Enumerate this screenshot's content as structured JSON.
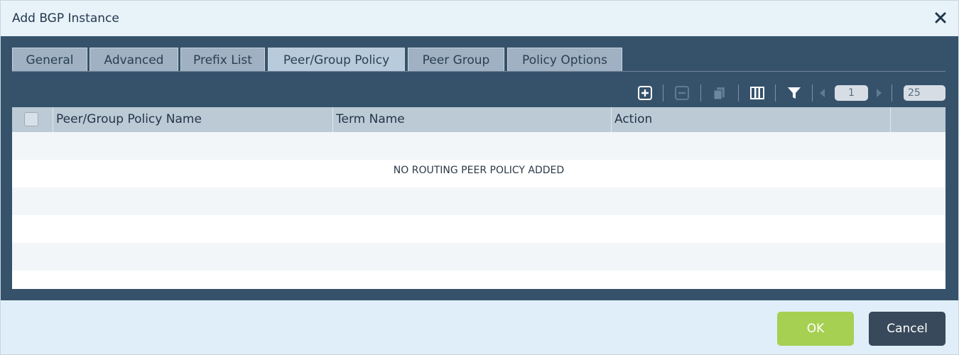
{
  "dialog": {
    "title": "Add BGP Instance"
  },
  "tabs": [
    {
      "label": "General"
    },
    {
      "label": "Advanced"
    },
    {
      "label": "Prefix List"
    },
    {
      "label": "Peer/Group Policy",
      "active": true
    },
    {
      "label": "Peer Group"
    },
    {
      "label": "Policy Options"
    }
  ],
  "toolbar": {
    "icons": [
      "add-icon",
      "remove-icon",
      "copy-icon",
      "columns-icon",
      "filter-icon",
      "prev-page-icon",
      "next-page-icon"
    ],
    "page_number": "1",
    "page_size": "25"
  },
  "table": {
    "columns": [
      "Peer/Group Policy Name",
      "Term Name",
      "Action"
    ],
    "empty_message": "NO ROUTING PEER POLICY ADDED"
  },
  "footer": {
    "ok_label": "OK",
    "cancel_label": "Cancel"
  },
  "colors": {
    "ok": "#a6d052",
    "cancel": "#38495b",
    "panel": "#36526b"
  }
}
